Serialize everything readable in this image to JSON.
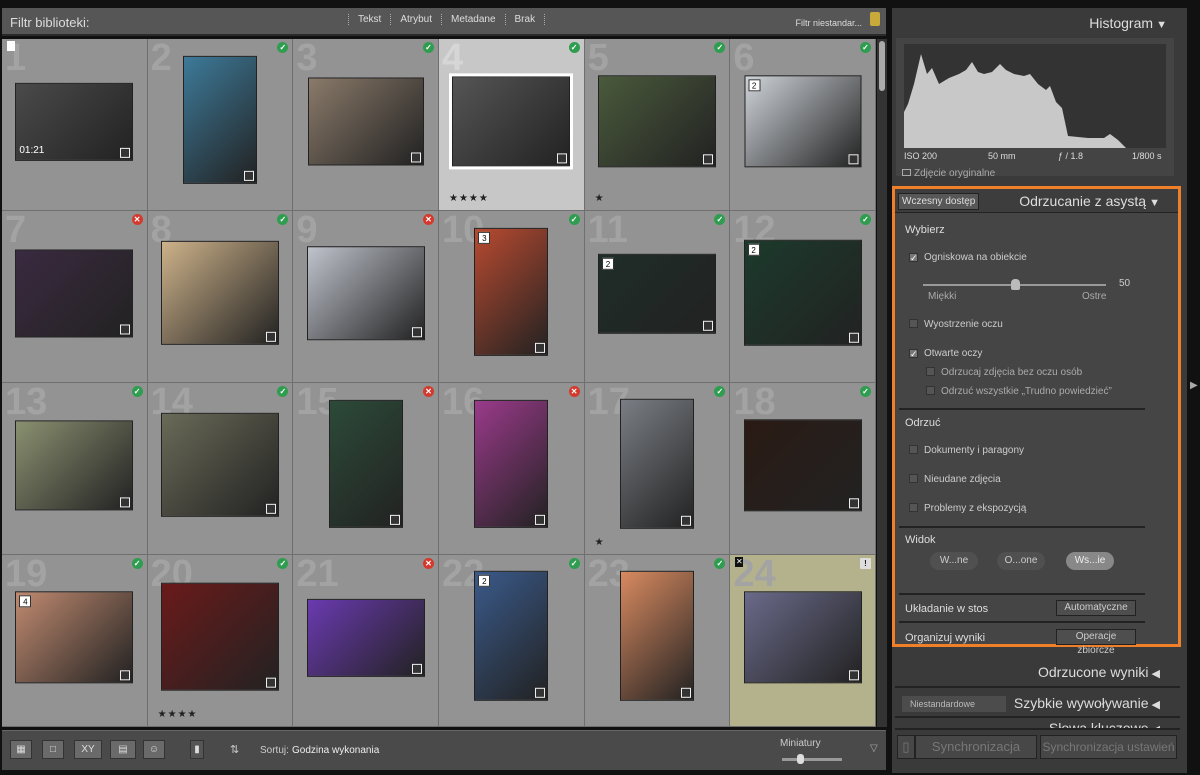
{
  "filter_bar": {
    "label": "Filtr biblioteki:",
    "tabs": [
      "Tekst",
      "Atrybut",
      "Metadane",
      "Brak"
    ],
    "preset": "Filtr niestandar...",
    "lock_icon": "lock-icon"
  },
  "grid": {
    "cells": [
      {
        "n": "1",
        "badge": "",
        "flag": "pick",
        "video": "01:21",
        "color": "#4a4a4a"
      },
      {
        "n": "2",
        "badge": "ok",
        "color": "#3d7a99"
      },
      {
        "n": "3",
        "badge": "ok",
        "color": "#8a7a6a"
      },
      {
        "n": "4",
        "badge": "ok",
        "stars": "★★★★",
        "selected": true,
        "color": "#555"
      },
      {
        "n": "5",
        "badge": "ok",
        "stars": "★",
        "color": "#4a5a3c"
      },
      {
        "n": "6",
        "badge": "ok",
        "stack": "2",
        "color": "#cfd4da"
      },
      {
        "n": "7",
        "badge": "rej",
        "color": "#3a2a40"
      },
      {
        "n": "8",
        "badge": "ok",
        "color": "#cdb28a"
      },
      {
        "n": "9",
        "badge": "rej",
        "color": "#bfc3cc"
      },
      {
        "n": "10",
        "badge": "ok",
        "stack": "3",
        "color": "#b84a30"
      },
      {
        "n": "11",
        "badge": "ok",
        "stack": "2",
        "color": "#1f2d28"
      },
      {
        "n": "12",
        "badge": "ok",
        "stack": "2",
        "color": "#1c3a2c"
      },
      {
        "n": "13",
        "badge": "ok",
        "color": "#8a9070"
      },
      {
        "n": "14",
        "badge": "ok",
        "color": "#6a6a58"
      },
      {
        "n": "15",
        "badge": "rej",
        "color": "#2c4a38"
      },
      {
        "n": "16",
        "badge": "rej",
        "color": "#9a3a8a"
      },
      {
        "n": "17",
        "badge": "ok",
        "stars": "★",
        "color": "#7a7e84"
      },
      {
        "n": "18",
        "badge": "ok",
        "color": "#2a1a14"
      },
      {
        "n": "19",
        "badge": "ok",
        "stack": "4",
        "color": "#c08a70"
      },
      {
        "n": "20",
        "badge": "ok",
        "stars": "★★★★",
        "color": "#6a1a1a"
      },
      {
        "n": "21",
        "badge": "rej",
        "color": "#6a3ab0"
      },
      {
        "n": "22",
        "badge": "ok",
        "stack": "2",
        "color": "#3a5a8a"
      },
      {
        "n": "23",
        "badge": "ok",
        "color": "#d88a60"
      },
      {
        "n": "24",
        "badge": "warn",
        "flag": "reject",
        "color": "#6a6a8a"
      }
    ]
  },
  "toolbar": {
    "sort_label": "Sortuj:",
    "sort_value": "Godzina wykonania",
    "thumbs_label": "Miniatury",
    "thumb_size_percent": 30,
    "view_buttons": [
      "grid-view",
      "loupe-view",
      "compare-view",
      "survey-view",
      "people-view"
    ],
    "compare_label": "XY"
  },
  "histogram": {
    "title": "Histogram",
    "iso": "ISO 200",
    "focal": "50 mm",
    "aperture": "ƒ / 1.8",
    "shutter": "1/800 s",
    "original_label": "Zdjęcie oryginalne"
  },
  "cull": {
    "early_access": "Wczesny dostęp",
    "title": "Odrzucanie z asystą",
    "select_heading": "Wybierz",
    "focus_label": "Ogniskowa na obiekcie",
    "focus_value": "50",
    "slider_min": "Miękki",
    "slider_max": "Ostre",
    "eye_sharp": "Wyostrzenie oczu",
    "eyes_open": "Otwarte oczy",
    "reject_no_eyes": "Odrzucaj zdjęcia bez oczu osób",
    "reject_unsure": "Odrzuć wszystkie „Trudno powiedzieć”",
    "reject_heading": "Odrzuć",
    "docs": "Dokumenty i paragony",
    "failed": "Nieudane zdjęcia",
    "exposure": "Problemy z ekspozycją",
    "view_heading": "Widok",
    "view_options": [
      "W...ne",
      "O...one",
      "Ws...ie"
    ],
    "view_selected": 2,
    "stack_label": "Układanie w stos",
    "stack_button": "Automatyczne",
    "organize_label": "Organizuj wyniki",
    "organize_button": "Operacje zbiorcze"
  },
  "panels": {
    "rejected": "Odrzucone wyniki",
    "quick_develop": "Szybkie wywoływanie",
    "quick_preset": "Niestandardowe",
    "keywords": "Słowa kluczowe"
  },
  "sync": {
    "sync": "Synchronizacja",
    "sync_settings": "Synchronizacja ustawień"
  }
}
